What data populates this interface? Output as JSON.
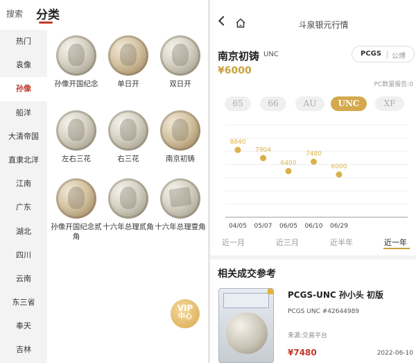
{
  "left": {
    "search_label": "搜索",
    "title": "分类",
    "sidebar": [
      {
        "label": "热门",
        "active": false
      },
      {
        "label": "袁像",
        "active": false
      },
      {
        "label": "孙像",
        "active": true
      },
      {
        "label": "船洋",
        "active": false
      },
      {
        "label": "大清帝国",
        "active": false
      },
      {
        "label": "直隶北洋",
        "active": false
      },
      {
        "label": "江南",
        "active": false
      },
      {
        "label": "广东",
        "active": false
      },
      {
        "label": "湖北",
        "active": false
      },
      {
        "label": "四川",
        "active": false
      },
      {
        "label": "云南",
        "active": false
      },
      {
        "label": "东三省",
        "active": false
      },
      {
        "label": "奉天",
        "active": false
      },
      {
        "label": "吉林",
        "active": false
      }
    ],
    "coins": [
      {
        "label": "孙像开国纪念"
      },
      {
        "label": "单日开"
      },
      {
        "label": "双日开"
      },
      {
        "label": "左右三花"
      },
      {
        "label": "右三花"
      },
      {
        "label": "南京初铸"
      },
      {
        "label": "孙像开国纪念贰角"
      },
      {
        "label": "十六年总理贰角"
      },
      {
        "label": "十六年总理壹角"
      }
    ],
    "vip": {
      "line1": "VIP",
      "line2": "中心"
    }
  },
  "right": {
    "nav_title": "斗泉银元行情",
    "coin_name": "南京初铸",
    "grade": "UNC",
    "pcgs": "PCGS",
    "public": "公博",
    "price": "¥6000",
    "pc_report": "PC数量报告:0",
    "grades": [
      {
        "label": "65",
        "active": false
      },
      {
        "label": "66",
        "active": false
      },
      {
        "label": "AU",
        "active": false
      },
      {
        "label": "UNC",
        "active": true
      },
      {
        "label": "XF",
        "active": false
      }
    ],
    "ranges": [
      {
        "label": "近一月",
        "active": false
      },
      {
        "label": "近三月",
        "active": false
      },
      {
        "label": "近半年",
        "active": false
      },
      {
        "label": "近一年",
        "active": true
      }
    ],
    "ref_title": "相关成交参考",
    "ref": {
      "name": "PCGS-UNC 孙小头 初版",
      "cert": "PCGS UNC #42644989",
      "source": "来源:交易平台",
      "price": "¥7480",
      "date": "2022-06-10"
    }
  },
  "chart_data": {
    "type": "scatter",
    "categories": [
      "04/05",
      "05/07",
      "06/05",
      "06/10",
      "06/29"
    ],
    "values": [
      8840,
      7904,
      6400,
      7480,
      6000
    ],
    "title": "",
    "xlabel": "",
    "ylabel": "",
    "grid": true,
    "point_color": "#d9b24a"
  }
}
